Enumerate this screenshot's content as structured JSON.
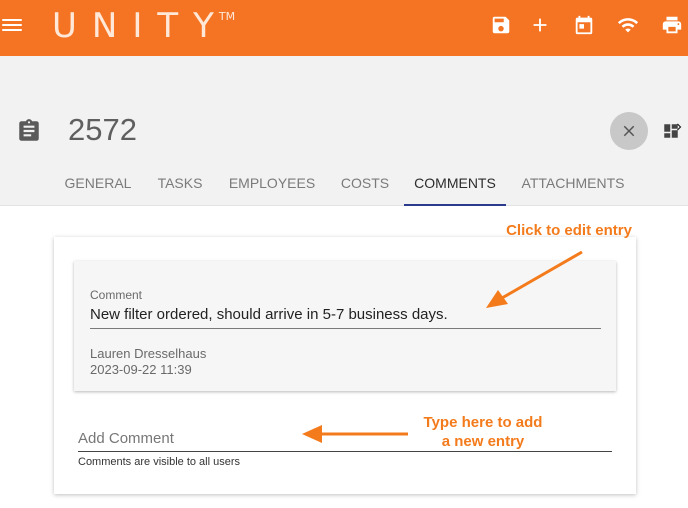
{
  "app": {
    "brand": "UNITY",
    "trademark": "TM"
  },
  "toolbar": {
    "icons": [
      "save-icon",
      "add-icon",
      "calendar-icon",
      "wifi-icon",
      "print-icon"
    ],
    "color": "#f47424"
  },
  "record": {
    "id": "2572"
  },
  "tabs": [
    {
      "label": "GENERAL"
    },
    {
      "label": "TASKS"
    },
    {
      "label": "EMPLOYEES"
    },
    {
      "label": "COSTS"
    },
    {
      "label": "COMMENTS",
      "active": true
    },
    {
      "label": "ATTACHMENTS"
    }
  ],
  "comment_entry": {
    "label": "Comment",
    "text": "New filter ordered, should arrive in 5-7 business days.",
    "author": "Lauren Dresselhaus",
    "timestamp": "2023-09-22 11:39"
  },
  "add_comment": {
    "placeholder": "Add Comment",
    "helper": "Comments are visible to all users"
  },
  "annotations": {
    "edit": "Click to edit entry",
    "add_line1": "Type here to add",
    "add_line2": "a new entry",
    "color": "#f47b1c"
  },
  "colors": {
    "accent": "#f47424",
    "tab_indicator": "#2a3a8c"
  }
}
